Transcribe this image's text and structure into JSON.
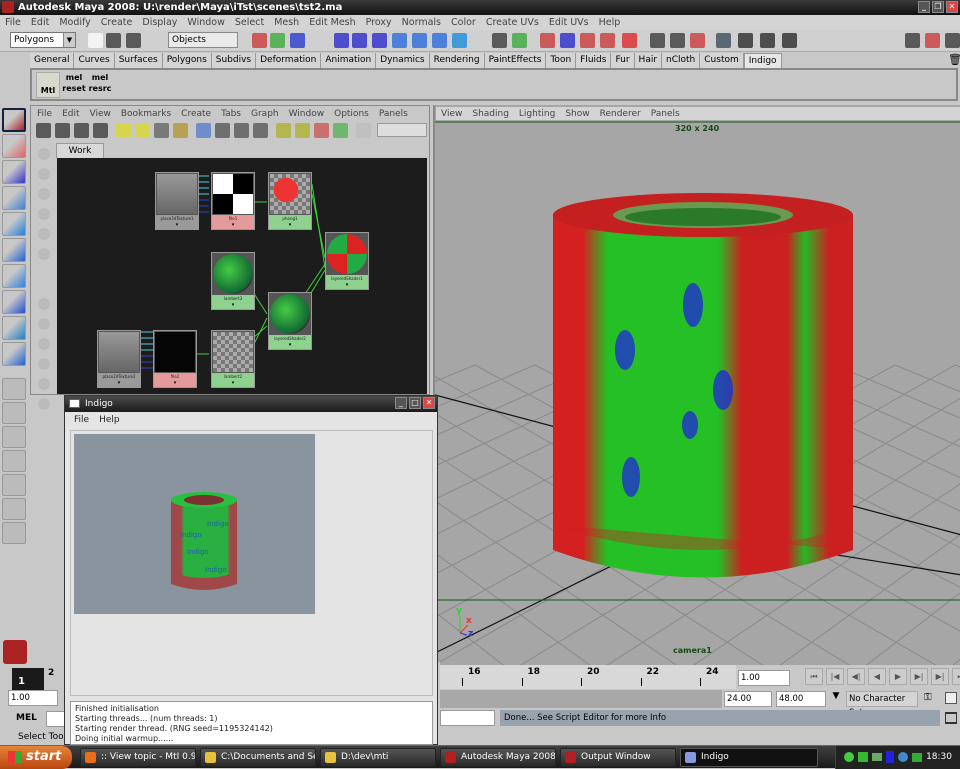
{
  "window": {
    "title": "Autodesk Maya 2008: U:\\render\\Maya\\iTst\\scenes\\tst2.ma",
    "minimize": "_",
    "restore": "❐",
    "close": "✕"
  },
  "main_menu": [
    "File",
    "Edit",
    "Modify",
    "Create",
    "Display",
    "Window",
    "Select",
    "Mesh",
    "Edit Mesh",
    "Proxy",
    "Normals",
    "Color",
    "Create UVs",
    "Edit UVs",
    "Help"
  ],
  "toolbar": {
    "mode": "Polygons",
    "selection_field": "Objects"
  },
  "shelf": {
    "tabs": [
      "General",
      "Curves",
      "Surfaces",
      "Polygons",
      "Subdivs",
      "Deformation",
      "Animation",
      "Dynamics",
      "Rendering",
      "PaintEffects",
      "Toon",
      "Fluids",
      "Fur",
      "Hair",
      "nCloth",
      "Custom",
      "Indigo"
    ],
    "active_tab": "Indigo",
    "buttons": [
      {
        "top": "",
        "label": "Mtl"
      },
      {
        "top": "mel",
        "label": "reset"
      },
      {
        "top": "mel",
        "label": "resrc"
      }
    ]
  },
  "hypershade": {
    "menu": [
      "File",
      "Edit",
      "View",
      "Bookmarks",
      "Create",
      "Tabs",
      "Graph",
      "Window",
      "Options",
      "Panels"
    ],
    "tab": "Work Area",
    "nodes": [
      {
        "name": "place2dTexture1",
        "kind": "t"
      },
      {
        "name": "file1",
        "kind": "p"
      },
      {
        "name": "phong1",
        "kind": "g"
      },
      {
        "name": "layeredShader1",
        "kind": "g"
      },
      {
        "name": "lambert3",
        "kind": "g"
      },
      {
        "name": "layeredShader2",
        "kind": "g"
      },
      {
        "name": "place2dTexture2",
        "kind": "t"
      },
      {
        "name": "file2",
        "kind": "p"
      },
      {
        "name": "lambert2",
        "kind": "g"
      }
    ]
  },
  "viewport": {
    "menu": [
      "View",
      "Shading",
      "Lighting",
      "Show",
      "Renderer",
      "Panels"
    ],
    "resolution": "320 x 240",
    "camera": "camera1",
    "axis": {
      "x": "x",
      "y": "y",
      "z": "z"
    }
  },
  "indigo": {
    "title": "Indigo",
    "menu": [
      "File",
      "Help"
    ],
    "render_text": "Indigo",
    "log": [
      "Finished initialisation",
      "Starting threads... (num threads: 1)",
      "Starting render thread. (RNG seed=1195324142)",
      "Doing initial warmup......"
    ]
  },
  "timeline": {
    "ticks": [
      "16",
      "18",
      "20",
      "22",
      "24"
    ],
    "current_frame_field": "1.00",
    "range_end": "24.00",
    "anim_end": "48.00",
    "character_set": "No Character Set",
    "playback": [
      "⏮",
      "|◀",
      "◀|",
      "◀",
      "▶",
      "▶|",
      "▶|",
      "⏭"
    ]
  },
  "left_bottom": {
    "current_frame": "1",
    "next_frame": "2",
    "start_field": "1.00",
    "mel_label": "MEL",
    "help_line": "Select Tool"
  },
  "status_line": "Done... See Script Editor for more Info",
  "taskbar": {
    "start": "start",
    "tasks": [
      {
        "label": ":: View topic - MtI 0.9...",
        "color": "#e8701a"
      },
      {
        "label": "C:\\Documents and Se...",
        "color": "#e8c040"
      },
      {
        "label": "D:\\dev\\mti",
        "color": "#e8c040"
      },
      {
        "label": "Autodesk Maya 2008...",
        "color": "#b02020"
      },
      {
        "label": "Output Window",
        "color": "#b02020"
      },
      {
        "label": "Indigo",
        "color": "#8899dd"
      }
    ],
    "active_task": "Indigo",
    "clock": "18:30"
  },
  "colors": {
    "accent_green": "#8fd28f",
    "file_node": "#e49a9a",
    "status_bg": "#99a3ad",
    "viewport_bg": "#a6a6a6"
  }
}
